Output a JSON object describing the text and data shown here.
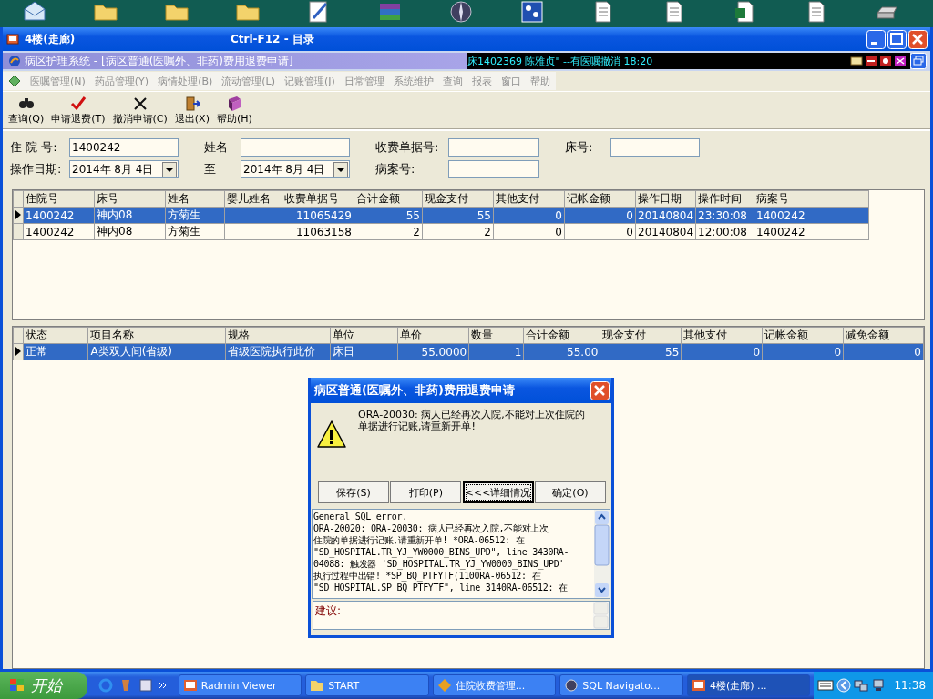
{
  "window": {
    "title": "4楼(走廊)",
    "hint": "Ctrl-F12 - 目录"
  },
  "child_window": {
    "title": "病区护理系统 - [病区普通(医嘱外、非药)费用退费申请]",
    "marquee": "床1402369 陈雅贞\" --有医嘱撤消 18:20"
  },
  "menu": [
    "医嘱管理(N)",
    "药品管理(Y)",
    "病情处理(B)",
    "流动管理(L)",
    "记账管理(J)",
    "日常管理",
    "系统维护",
    "查询",
    "报表",
    "窗口",
    "帮助"
  ],
  "toolbar": [
    {
      "label": "查询(Q)",
      "kind": "binoculars"
    },
    {
      "label": "申请退费(T)",
      "kind": "check"
    },
    {
      "label": "撤消申请(C)",
      "kind": "cross"
    },
    {
      "label": "退出(X)",
      "kind": "exit"
    },
    {
      "label": "帮助(H)",
      "kind": "book"
    }
  ],
  "form": [
    [
      {
        "label": "住 院 号:",
        "value": "1400242",
        "kind": "text"
      },
      {
        "label": "姓名",
        "kind": "text"
      },
      {
        "label": "收费单据号:",
        "kind": "text"
      },
      {
        "label": "床号:",
        "kind": "text"
      }
    ],
    [
      {
        "label": "操作日期:",
        "value": "2014年 8月 4日",
        "kind": "date"
      },
      {
        "label": "至",
        "value": "2014年 8月 4日",
        "kind": "date"
      },
      {
        "label": "病案号:",
        "kind": "text"
      }
    ]
  ],
  "grid1": {
    "columns": [
      {
        "label": "住院号",
        "numeric": false
      },
      {
        "label": "床号",
        "numeric": false
      },
      {
        "label": "姓名",
        "numeric": false
      },
      {
        "label": "婴儿姓名"
      },
      {
        "label": "收费单据号",
        "numeric": true
      },
      {
        "label": "合计金额",
        "numeric": true
      },
      {
        "label": "现金支付",
        "numeric": true
      },
      {
        "label": "其他支付",
        "numeric": true
      },
      {
        "label": "记帐金额",
        "numeric": true
      },
      {
        "label": "操作日期"
      },
      {
        "label": "操作时间",
        "numeric": false
      },
      {
        "label": "病案号",
        "numeric": false
      }
    ],
    "rows": [
      {
        "selected": true,
        "cells": [
          "1400242",
          "神内08",
          "方菊生",
          "",
          "11065429",
          "55",
          "55",
          "0",
          "0",
          "20140804",
          "23:30:08",
          "1400242"
        ]
      },
      {
        "selected": false,
        "cells": [
          "1400242",
          "神内08",
          "方菊生",
          "",
          "11063158",
          "2",
          "2",
          "0",
          "0",
          "20140804",
          "12:00:08",
          "1400242"
        ]
      }
    ]
  },
  "grid2": {
    "columns": [
      {
        "label": "状态",
        "numeric": false
      },
      {
        "label": "项目名称",
        "numeric": false
      },
      {
        "label": "规格",
        "numeric": false
      },
      {
        "label": "单位",
        "numeric": false
      },
      {
        "label": "单价",
        "numeric": true
      },
      {
        "label": "数量",
        "numeric": true
      },
      {
        "label": "合计金额",
        "numeric": true
      },
      {
        "label": "现金支付",
        "numeric": true
      },
      {
        "label": "其他支付",
        "numeric": true
      },
      {
        "label": "记帐金额",
        "numeric": true
      },
      {
        "label": "减免金额",
        "numeric": true
      }
    ],
    "rows": [
      {
        "selected": true,
        "cells": [
          "正常",
          "A类双人间(省级)",
          "省级医院执行此价",
          "床日",
          "55.0000",
          "1",
          "55.00",
          "55",
          "0",
          "0",
          "0"
        ]
      }
    ]
  },
  "dialog": {
    "title": "病区普通(医嘱外、非药)费用退费申请",
    "message_lines": [
      "ORA-20030: 病人已经再次入院,不能对上次住院的",
      "单据进行记账,请重新开单!"
    ],
    "buttons": [
      {
        "label": "保存(S)",
        "focused": false
      },
      {
        "label": "打印(P)",
        "focused": false
      },
      {
        "label": "<<<详细情况",
        "focused": true
      },
      {
        "label": "确定(O)",
        "focused": false
      }
    ],
    "details_lines": [
      "General SQL error.",
      "ORA-20020: ORA-20030: 病人已经再次入院,不能对上次",
      "住院的单据进行记账,请重新开单! *ORA-06512: 在",
      "\"SD_HOSPITAL.TR_YJ_YW0000_BINS_UPD\", line 3430RA-",
      "04088: 触发器 'SD_HOSPITAL.TR_YJ_YW0000_BINS_UPD'",
      "执行过程中出错! *SP_BQ_PTFYTF(1100RA-06512: 在",
      "\"SD_HOSPITAL.SP_BQ_PTFYTF\", line 3140RA-06512: 在"
    ],
    "suggestion_label": "建议:"
  },
  "taskbar": {
    "start": "开始",
    "tasks": [
      {
        "label": "Radmin Viewer",
        "selected": false
      },
      {
        "label": "START",
        "selected": false
      },
      {
        "label": "住院收费管理...",
        "selected": false
      },
      {
        "label": "SQL Navigato...",
        "selected": false
      },
      {
        "label": "4楼(走廊)     ...",
        "selected": true
      }
    ],
    "clock": "11:38"
  }
}
